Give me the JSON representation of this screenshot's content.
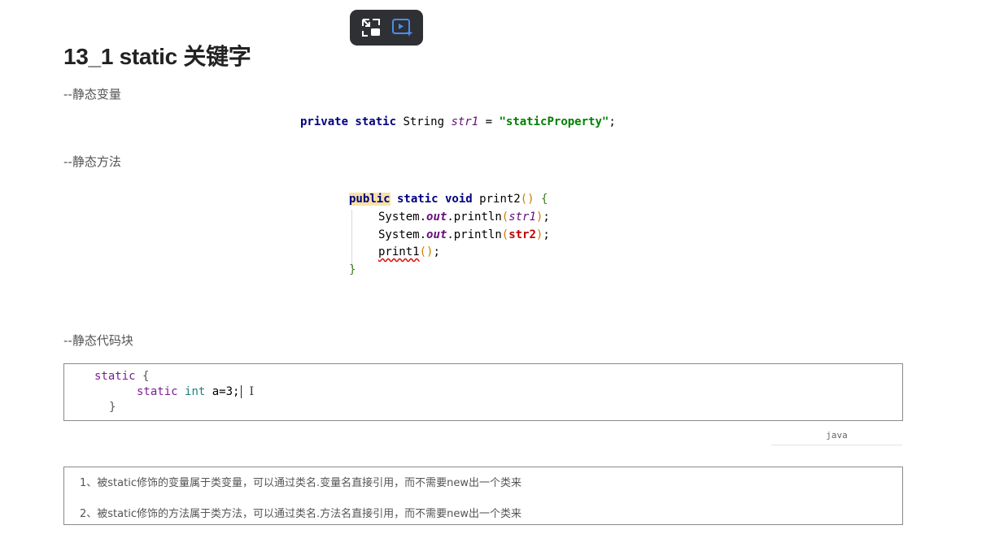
{
  "title": "13_1 static 关键字",
  "sections": {
    "static_var": "--静态变量",
    "static_method": "--静态方法",
    "static_block": "--静态代码块"
  },
  "code1": {
    "kw": "private static",
    "type": " String ",
    "field": "str1",
    "eq": " = ",
    "value": "\"staticProperty\"",
    "end": ";"
  },
  "code2": {
    "public": "public",
    "sig": " static void",
    "name": " print2",
    "parens": "()",
    "open": " {",
    "l1_pre": "System.",
    "out": "out",
    "l1_mid": ".println",
    "paren_open": "(",
    "arg1": "str1",
    "paren_close": ")",
    "semi": ";",
    "arg2": "str2",
    "call": "print1",
    "call_parens": "()",
    "close": "}"
  },
  "code3": {
    "line1_kw": "static",
    "line1_brace": " {",
    "line2_kw": "static",
    "line2_type": "int",
    "line2_rest": " a=3;",
    "line3": "}"
  },
  "lang_label": "java",
  "notes": [
    "1、被static修饰的变量属于类变量，可以通过类名.变量名直接引用，而不需要new出一个类来",
    "2、被static修饰的方法属于类方法，可以通过类名.方法名直接引用，而不需要new出一个类来"
  ],
  "icons": {
    "exit_pip": "exit-picture-in-picture-icon",
    "video_ai": "video-sparkle-icon"
  },
  "colors": {
    "toolbar_bg": "#2f3033",
    "accent_blue": "#4a8df0"
  }
}
